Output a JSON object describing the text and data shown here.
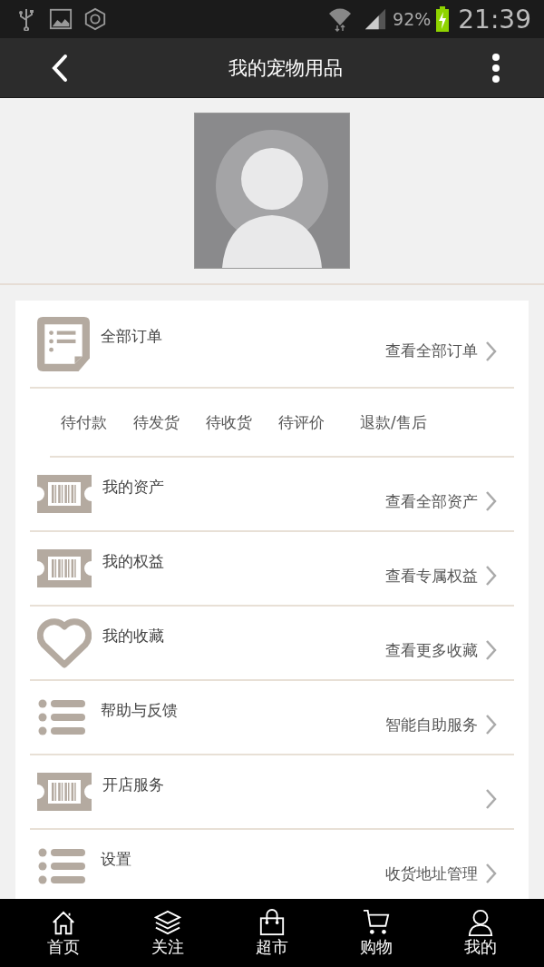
{
  "status_bar": {
    "battery": "92%",
    "time": "21:39"
  },
  "toolbar": {
    "title": "我的宠物用品"
  },
  "orders": {
    "label": "全部订单",
    "link": "查看全部订单",
    "statuses": [
      "待付款",
      "待发货",
      "待收货",
      "待评价",
      "退款/售后"
    ]
  },
  "menu": [
    {
      "kind": "ticket",
      "label": "我的资产",
      "link": "查看全部资产"
    },
    {
      "kind": "ticket",
      "label": "我的权益",
      "link": "查看专属权益"
    },
    {
      "kind": "heart",
      "label": "我的收藏",
      "link": "查看更多收藏"
    },
    {
      "kind": "list",
      "label": "帮助与反馈",
      "link": "智能自助服务"
    },
    {
      "kind": "ticket",
      "label": "开店服务"
    },
    {
      "kind": "list",
      "label": "设置",
      "link": "收货地址管理"
    }
  ],
  "nav": [
    {
      "kind": "home",
      "label": "首页"
    },
    {
      "kind": "layers",
      "label": "关注"
    },
    {
      "kind": "bag",
      "label": "超市"
    },
    {
      "kind": "cart",
      "label": "购物"
    },
    {
      "kind": "person",
      "label": "我的"
    }
  ]
}
